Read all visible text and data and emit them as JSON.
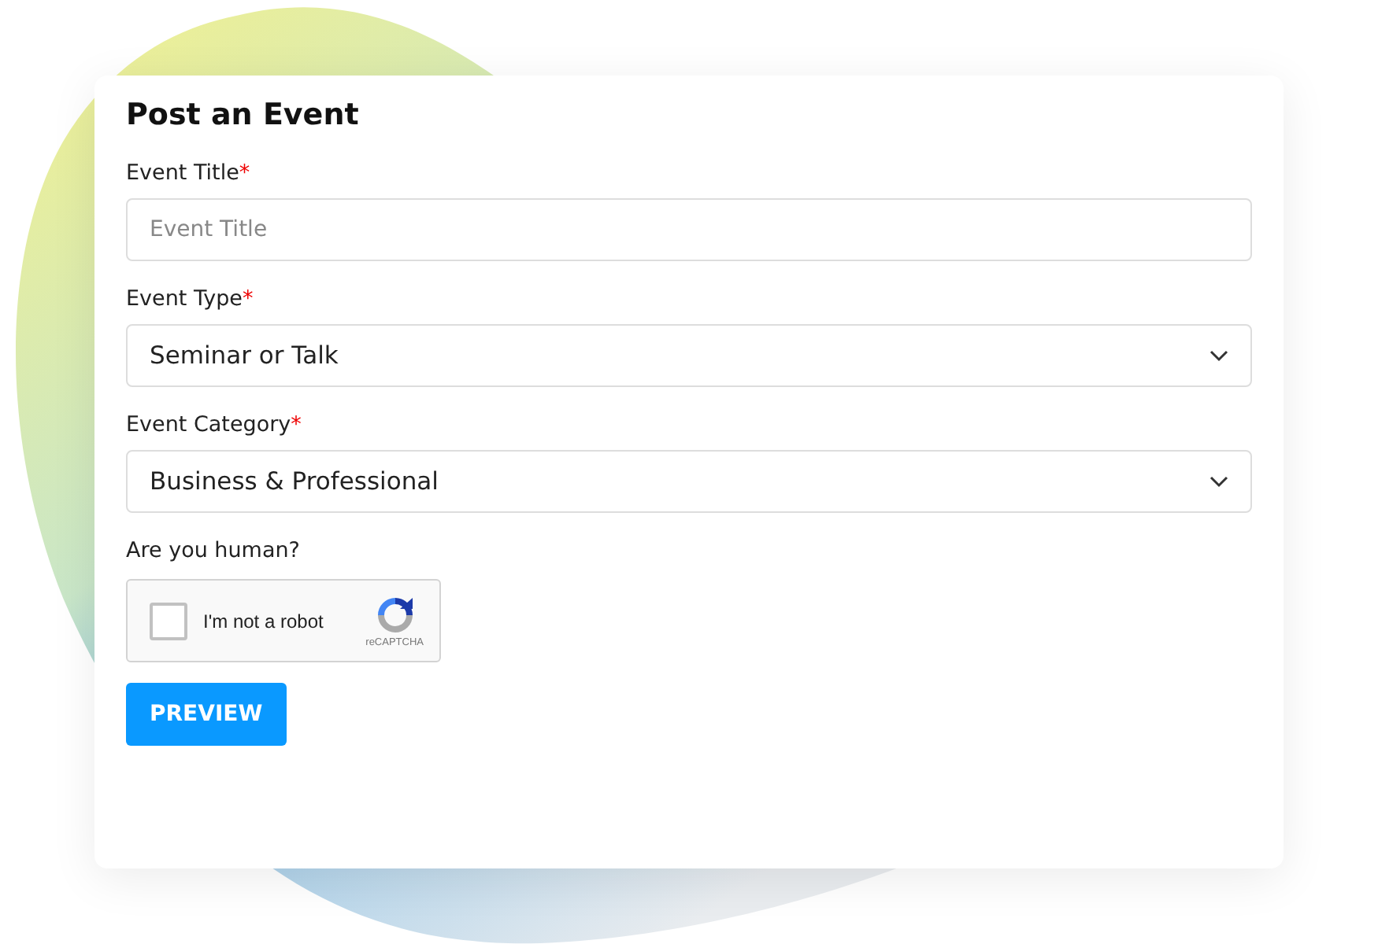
{
  "form": {
    "title": "Post an Event",
    "fields": [
      {
        "kind": "text",
        "label": "Event Title",
        "required_mark": "*",
        "placeholder": "Event Title"
      },
      {
        "kind": "select",
        "label": "Event Type",
        "required_mark": "*",
        "value": "Seminar or Talk"
      },
      {
        "kind": "select",
        "label": "Event Category",
        "required_mark": "*",
        "value": "Business & Professional"
      }
    ],
    "captcha": {
      "label": "Are you human?",
      "checked": false,
      "text": "I'm not a robot",
      "brand": "reCAPTCHA"
    },
    "buttons": [
      "PREVIEW"
    ]
  }
}
